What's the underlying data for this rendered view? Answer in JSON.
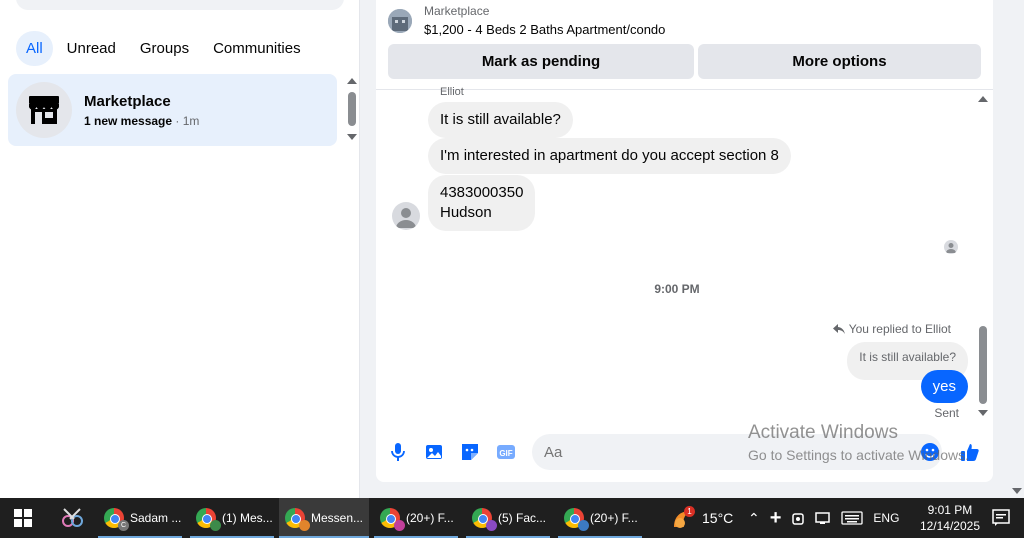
{
  "sidebar": {
    "filters": [
      "All",
      "Unread",
      "Groups",
      "Communities"
    ],
    "active_filter": "All",
    "conversation": {
      "title": "Marketplace",
      "subtitle_bold": "1 new message",
      "subtitle_time": " · 1m"
    }
  },
  "chat_header": {
    "source": "Marketplace",
    "listing_title": "$1,200 - 4 Beds 2 Baths Apartment/condo",
    "mark_pending_label": "Mark as pending",
    "more_options_label": "More options"
  },
  "messages": {
    "sender_name": "Elliot",
    "incoming": [
      "It is still available?",
      "I'm interested in apartment do you accept section 8",
      "4383000350\nHudson"
    ],
    "time_separator": "9:00 PM",
    "replied_label": "You replied to Elliot",
    "quoted_text": "It is still available?",
    "outgoing": "yes",
    "status": "Sent"
  },
  "composer": {
    "placeholder": "Aa"
  },
  "watermark": {
    "line1": "Activate Windows",
    "line2": "Go to Settings to activate Windows."
  },
  "taskbar": {
    "apps": [
      {
        "label": "Sadam ...",
        "badge": "C"
      },
      {
        "label": "(1) Mes...",
        "badge": ""
      },
      {
        "label": "Messen...",
        "badge": ""
      },
      {
        "label": "(20+) F...",
        "badge": ""
      },
      {
        "label": "(5) Fac...",
        "badge": ""
      },
      {
        "label": "(20+) F...",
        "badge": ""
      }
    ],
    "weather_badge": "1",
    "temperature": "15°C",
    "language": "ENG",
    "time": "9:01 PM",
    "date": "12/14/2025"
  },
  "colors": {
    "accent": "#0866ff",
    "active_bg": "#e7f0fc"
  }
}
